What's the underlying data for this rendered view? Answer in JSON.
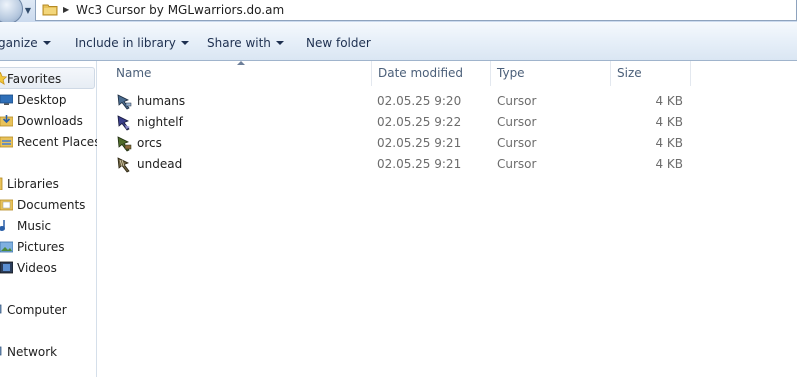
{
  "window": {
    "address_path": "Wc3 Cursor by MGLwarriors.do.am"
  },
  "toolbar": {
    "organize_label": "ganize",
    "include_library_label": "Include in library",
    "share_with_label": "Share with",
    "new_folder_label": "New folder"
  },
  "nav": {
    "favorites": "Favorites",
    "desktop": "Desktop",
    "downloads": "Downloads",
    "recent_places": "Recent Places",
    "libraries": "Libraries",
    "documents": "Documents",
    "music": "Music",
    "pictures": "Pictures",
    "videos": "Videos",
    "computer": "Computer",
    "network": "Network"
  },
  "columns": {
    "name": "Name",
    "date_modified": "Date modified",
    "type": "Type",
    "size": "Size"
  },
  "files": [
    {
      "name": "humans",
      "date": "02.05.25 9:20",
      "type": "Cursor",
      "size": "4 KB",
      "icon": "cursor-icon-humans",
      "color": "#4a6b8e"
    },
    {
      "name": "nightelf",
      "date": "02.05.25 9:22",
      "type": "Cursor",
      "size": "4 KB",
      "icon": "cursor-icon-nightelf",
      "color": "#3a3f8a"
    },
    {
      "name": "orcs",
      "date": "02.05.25 9:21",
      "type": "Cursor",
      "size": "4 KB",
      "icon": "cursor-icon-orcs",
      "color": "#4f6b2a"
    },
    {
      "name": "undead",
      "date": "02.05.25 9:21",
      "type": "Cursor",
      "size": "4 KB",
      "icon": "cursor-icon-undead",
      "color": "#6b6040"
    }
  ]
}
